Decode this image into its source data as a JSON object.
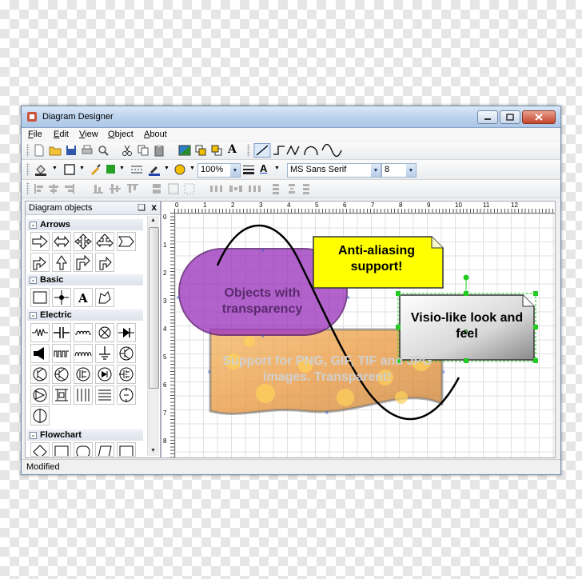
{
  "window": {
    "title": "Diagram Designer"
  },
  "menu": [
    "File",
    "Edit",
    "View",
    "Object",
    "About"
  ],
  "toolbar": {
    "zoom": "100%",
    "font": "MS Sans Serif",
    "font_size": "8",
    "text_tool": "A"
  },
  "panel": {
    "title": "Diagram objects",
    "pin": "❑",
    "close": "x",
    "categories": [
      "Arrows",
      "Basic",
      "Electric",
      "Flowchart"
    ],
    "basic_text_symbol": "A"
  },
  "canvas": {
    "ruler_h": [
      "0",
      "1",
      "2",
      "3",
      "4",
      "5",
      "6",
      "7",
      "8",
      "9",
      "10",
      "11",
      "12"
    ],
    "ruler_v": [
      "0",
      "1",
      "2",
      "3",
      "4",
      "5",
      "6",
      "7",
      "8"
    ],
    "shapes": {
      "transparency": "Objects with transparency",
      "antialias": "Anti-aliasing support!",
      "visio": "Visio-like look and feel",
      "png": "Support for PNG, GIF, TIF and JPG images. Transparent!"
    }
  },
  "status": "Modified",
  "colors": {
    "titlebar": "#bcd3ee",
    "purple": "#a03bbf",
    "yellow": "#ffff00",
    "selection": "#22cc22"
  }
}
